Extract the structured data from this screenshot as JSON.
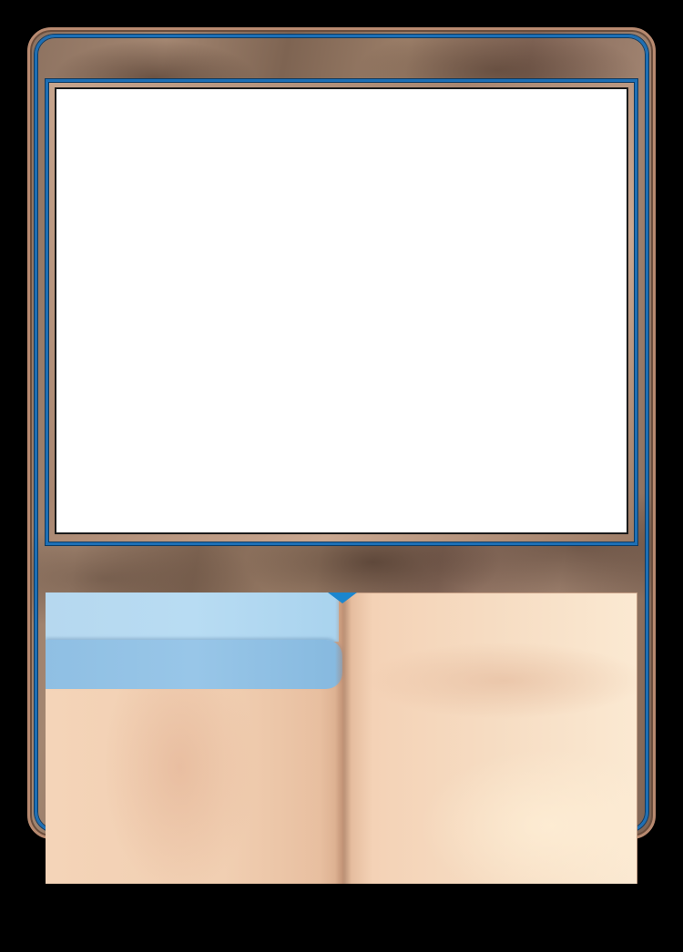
{
  "card": {
    "colors": {
      "background": "#000000",
      "wood_frame": "#8d7260",
      "blue_trim": "#1d6fb5",
      "art_panel": "#ffffff",
      "page": "#f4d4b8",
      "banner_light": "#b8dcf3",
      "banner_dark": "#98c6e8",
      "spine_accent": "#1b86cf"
    },
    "regions": {
      "art": "blank",
      "text_box": "open-book"
    }
  }
}
